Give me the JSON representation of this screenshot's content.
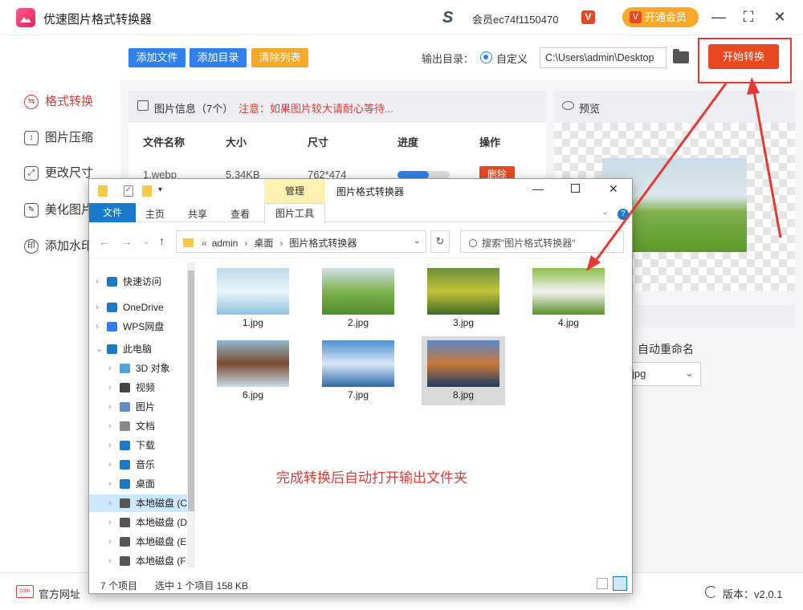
{
  "app": {
    "title": "优速图片格式转换器",
    "user": "会员ec74f1150470",
    "vip_badge": "V",
    "vip_button": "开通会员"
  },
  "window_controls": {
    "minimize": "—",
    "maximize": "⛶",
    "close": "✕"
  },
  "sidebar": {
    "items": [
      {
        "label": "格式转换",
        "icon": "format-convert-icon",
        "active": true
      },
      {
        "label": "图片压缩",
        "icon": "compress-icon"
      },
      {
        "label": "更改尺寸",
        "icon": "resize-icon"
      },
      {
        "label": "美化图片",
        "icon": "beautify-icon"
      },
      {
        "label": "添加水印",
        "icon": "watermark-icon"
      }
    ]
  },
  "toolbar": {
    "add_file": "添加文件",
    "add_dir": "添加目录",
    "clear_list": "清除列表",
    "output_label": "输出目录：",
    "custom_label": "自定义",
    "output_path": "C:\\Users\\admin\\Desktop",
    "start": "开始转换"
  },
  "fileinfo": {
    "label": "图片信息（7个）",
    "note": "注意：如果图片较大请耐心等待..."
  },
  "table": {
    "headers": [
      "文件名称",
      "大小",
      "尺寸",
      "进度",
      "操作"
    ],
    "rows": [
      {
        "name": "1.webp",
        "size": "5.34KB",
        "dims": "762*474",
        "progress": 0.6,
        "action": "删除"
      }
    ]
  },
  "preview": {
    "label": "预览"
  },
  "settings": {
    "rename": "自动重命名",
    "format": "jpg"
  },
  "bottom": {
    "site": "官方网址",
    "version_label": "版本：",
    "version": "v2.0.1"
  },
  "explorer": {
    "manage_tab": "管理",
    "title": "图片格式转换器",
    "tabs": [
      "文件",
      "主页",
      "共享",
      "查看",
      "图片工具"
    ],
    "address": {
      "prefix": "«",
      "parts": [
        "admin",
        "桌面",
        "图片格式转换器"
      ]
    },
    "search_placeholder": "搜索\"图片格式转换器\"",
    "tree": [
      {
        "label": "快速访问",
        "icon": "star-icon",
        "level": 0
      },
      {
        "label": "OneDrive",
        "icon": "cloud-icon",
        "level": 0
      },
      {
        "label": "WPS网盘",
        "icon": "wps-cloud-icon",
        "level": 0
      },
      {
        "label": "此电脑",
        "icon": "pc-icon",
        "level": 0,
        "expanded": true
      },
      {
        "label": "3D 对象",
        "icon": "cube-icon",
        "level": 1
      },
      {
        "label": "视频",
        "icon": "video-icon",
        "level": 1
      },
      {
        "label": "图片",
        "icon": "picture-icon",
        "level": 1
      },
      {
        "label": "文档",
        "icon": "document-icon",
        "level": 1
      },
      {
        "label": "下载",
        "icon": "download-icon",
        "level": 1
      },
      {
        "label": "音乐",
        "icon": "music-icon",
        "level": 1
      },
      {
        "label": "桌面",
        "icon": "desktop-icon",
        "level": 1
      },
      {
        "label": "本地磁盘 (C",
        "icon": "drive-icon",
        "level": 1,
        "selected": true
      },
      {
        "label": "本地磁盘 (D",
        "icon": "drive-icon",
        "level": 1
      },
      {
        "label": "本地磁盘 (E",
        "icon": "drive-icon",
        "level": 1
      },
      {
        "label": "本地磁盘 (F:",
        "icon": "drive-icon",
        "level": 1
      }
    ],
    "files": [
      {
        "name": "1.jpg",
        "colors": [
          "#bcdcef",
          "#e9f4fb",
          "#8fc2df"
        ]
      },
      {
        "name": "2.jpg",
        "colors": [
          "#cfe0ea",
          "#7eb24d",
          "#4f8d2a"
        ]
      },
      {
        "name": "3.jpg",
        "colors": [
          "#6a8f3a",
          "#c5c23a",
          "#3b6a22"
        ]
      },
      {
        "name": "4.jpg",
        "colors": [
          "#8cbf47",
          "#f3f3f0",
          "#5a9327"
        ]
      },
      {
        "name": "6.jpg",
        "colors": [
          "#8fb8d0",
          "#7a4b2e",
          "#c5dbe7"
        ]
      },
      {
        "name": "7.jpg",
        "colors": [
          "#4b8ed0",
          "#d9e9f6",
          "#2d6aa8"
        ]
      },
      {
        "name": "8.jpg",
        "colors": [
          "#5c87c8",
          "#c97a3a",
          "#213b63"
        ],
        "selected": true
      }
    ],
    "message": "完成转换后自动打开输出文件夹",
    "status_count": "7 个项目",
    "status_sel": "选中 1 个项目  158 KB"
  },
  "colors": {
    "accent": "#e8481f",
    "blue": "#2f80ed",
    "orange": "#f9a825",
    "highlight": "#e53935"
  }
}
